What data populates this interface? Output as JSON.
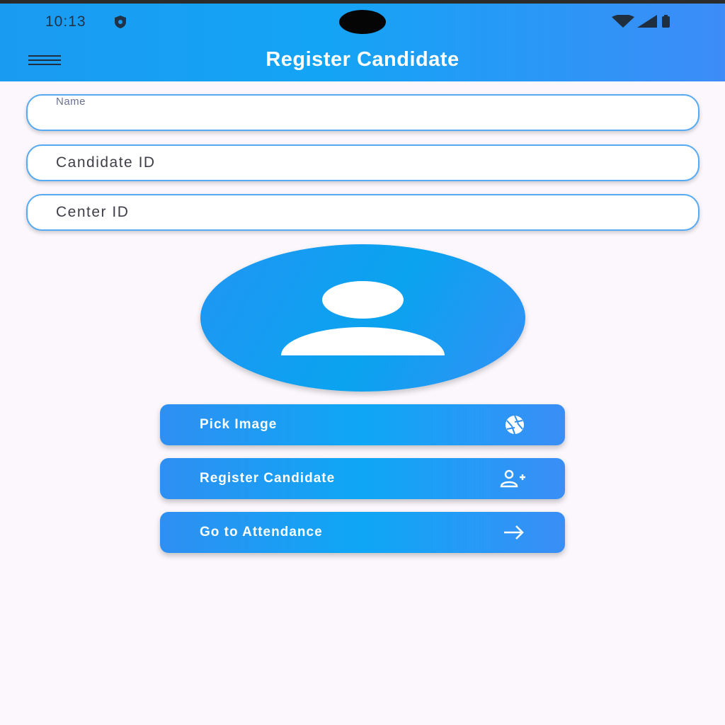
{
  "status_bar": {
    "time": "10:13"
  },
  "app_bar": {
    "title": "Register Candidate"
  },
  "form": {
    "name_field": {
      "label": "Name",
      "value": ""
    },
    "candidate_id_field": {
      "placeholder": "Candidate ID",
      "value": ""
    },
    "center_id_field": {
      "placeholder": "Center ID",
      "value": ""
    }
  },
  "buttons": {
    "pick_image": {
      "label": "Pick Image",
      "icon": "camera-shutter-icon"
    },
    "register_candidate": {
      "label": "Register Candidate",
      "icon": "person-add-icon"
    },
    "go_to_attendance": {
      "label": "Go to Attendance",
      "icon": "arrow-right-icon"
    }
  },
  "colors": {
    "app_bar_gradient_start": "#1a9bf2",
    "app_bar_gradient_end": "#3d8cf7",
    "field_border": "#56a9f3",
    "background": "#fbf7fc"
  }
}
